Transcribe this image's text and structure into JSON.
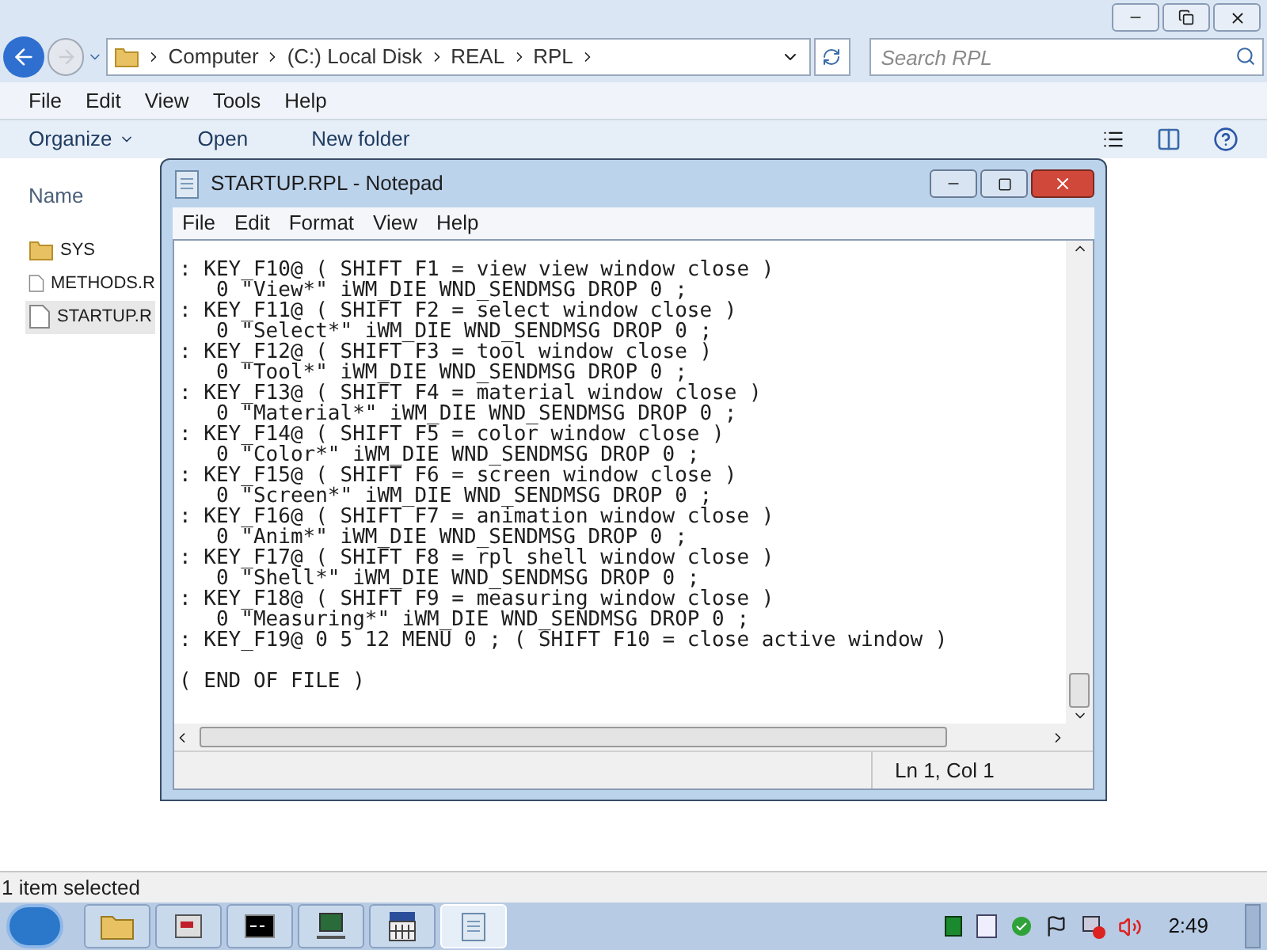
{
  "explorer": {
    "breadcrumbs": [
      "Computer",
      "(C:) Local Disk",
      "REAL",
      "RPL"
    ],
    "search": {
      "placeholder": "Search RPL"
    },
    "menu": [
      "File",
      "Edit",
      "View",
      "Tools",
      "Help"
    ],
    "toolbar": {
      "organize": "Organize",
      "buttons": [
        "Open",
        "New folder"
      ]
    },
    "column_header": "Name",
    "files": [
      {
        "name": "SYS",
        "kind": "folder",
        "selected": false
      },
      {
        "name": "METHODS.R",
        "kind": "file",
        "selected": false
      },
      {
        "name": "STARTUP.R",
        "kind": "file",
        "selected": true
      }
    ],
    "status_bar": "1 item selected"
  },
  "notepad": {
    "title": "STARTUP.RPL - Notepad",
    "menu": [
      "File",
      "Edit",
      "Format",
      "View",
      "Help"
    ],
    "lines": [
      ": KEY_F10@ ( SHIFT F1 = view view window close )",
      "   0 \"View*\" iWM_DIE WND_SENDMSG DROP 0 ;",
      ": KEY_F11@ ( SHIFT F2 = select window close )",
      "   0 \"Select*\" iWM_DIE WND_SENDMSG DROP 0 ;",
      ": KEY_F12@ ( SHIFT F3 = tool window close )",
      "   0 \"Tool*\" iWM_DIE WND_SENDMSG DROP 0 ;",
      ": KEY_F13@ ( SHIFT F4 = material window close )",
      "   0 \"Material*\" iWM_DIE WND_SENDMSG DROP 0 ;",
      ": KEY_F14@ ( SHIFT F5 = color window close )",
      "   0 \"Color*\" iWM_DIE WND_SENDMSG DROP 0 ;",
      ": KEY_F15@ ( SHIFT F6 = screen window close )",
      "   0 \"Screen*\" iWM_DIE WND_SENDMSG DROP 0 ;",
      ": KEY_F16@ ( SHIFT F7 = animation window close )",
      "   0 \"Anim*\" iWM_DIE WND_SENDMSG DROP 0 ;",
      ": KEY_F17@ ( SHIFT F8 = rpl shell window close )",
      "   0 \"Shell*\" iWM_DIE WND_SENDMSG DROP 0 ;",
      ": KEY_F18@ ( SHIFT F9 = measuring window close )",
      "   0 \"Measuring*\" iWM_DIE WND_SENDMSG DROP 0 ;",
      ": KEY_F19@ 0 5 12 MENU 0 ; ( SHIFT F10 = close active window )"
    ],
    "trailer": "( END OF FILE )",
    "status": "Ln 1, Col 1"
  },
  "taskbar": {
    "apps": [
      {
        "kind": "folder",
        "selected": false
      },
      {
        "kind": "app",
        "selected": false
      },
      {
        "kind": "console",
        "selected": false
      },
      {
        "kind": "monitor",
        "selected": false
      },
      {
        "kind": "calculator",
        "selected": false
      },
      {
        "kind": "notepad",
        "selected": true
      }
    ],
    "clock": "2:49"
  }
}
